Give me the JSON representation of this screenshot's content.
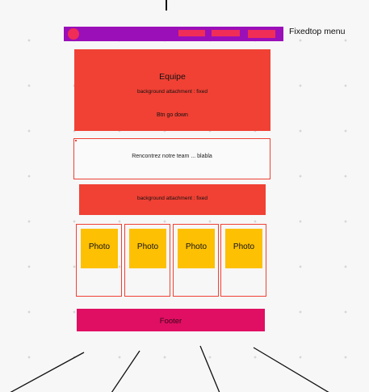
{
  "menu": {
    "caption": "Fixedtop menu"
  },
  "hero": {
    "title": "Equipe",
    "subtitle": "background attachment : fixed",
    "button_text": "Btn go down"
  },
  "team": {
    "text": "Rencontrez notre team ... blabla"
  },
  "band": {
    "text": "background attachment : fixed"
  },
  "photos": [
    {
      "label": "Photo"
    },
    {
      "label": "Photo"
    },
    {
      "label": "Photo"
    },
    {
      "label": "Photo"
    }
  ],
  "footer": {
    "text": "Footer"
  },
  "colors": {
    "menu_bar": "#9b0fb8",
    "menu_items": "#ef2d57",
    "section_red": "#f04134",
    "photo_yellow": "#fdc003",
    "footer_pink": "#e00f63"
  }
}
